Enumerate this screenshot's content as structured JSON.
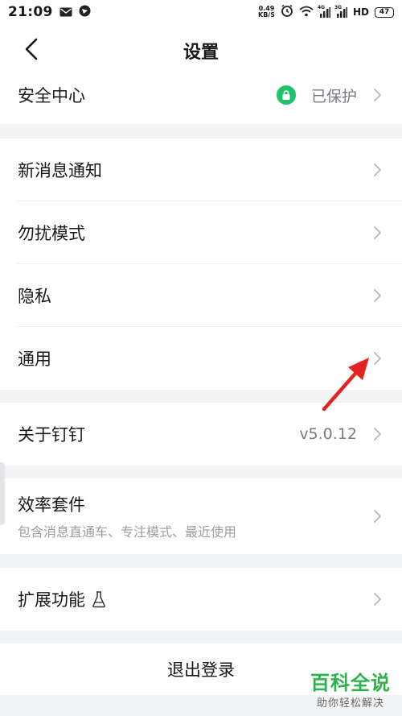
{
  "status_bar": {
    "time": "21:09",
    "speed_value": "0.49",
    "speed_unit": "KB/S",
    "net1": "4G",
    "net2": "3G",
    "hd": "HD",
    "battery": "47"
  },
  "header": {
    "title": "设置"
  },
  "rows": {
    "security": {
      "label": "安全中心",
      "value": "已保护"
    },
    "notifications": {
      "label": "新消息通知"
    },
    "dnd": {
      "label": "勿扰模式"
    },
    "privacy": {
      "label": "隐私"
    },
    "general": {
      "label": "通用"
    },
    "about": {
      "label": "关于钉钉",
      "value": "v5.0.12"
    },
    "efficiency": {
      "label": "效率套件",
      "sub": "包含消息直通车、专注模式、最近使用"
    },
    "extensions": {
      "label": "扩展功能"
    },
    "logout": {
      "label": "退出登录"
    }
  },
  "watermark": {
    "title": "百科全说",
    "subtitle": "助你轻松解决"
  },
  "colors": {
    "accent_green": "#1fc26b",
    "annotation_red": "#e52222",
    "watermark_green": "#2db34a"
  }
}
